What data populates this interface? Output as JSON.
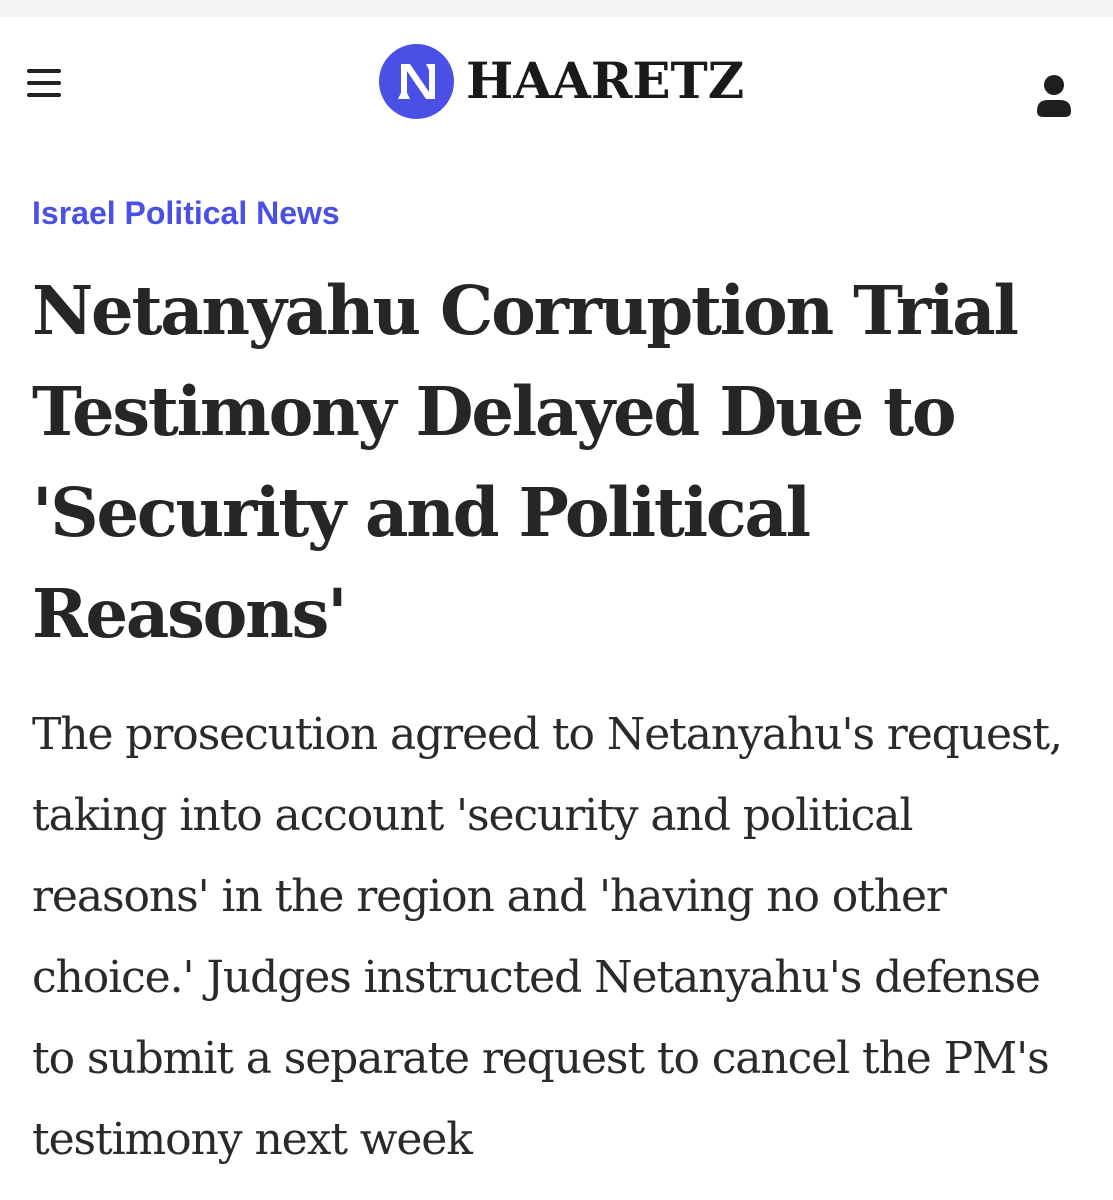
{
  "header": {
    "menu_icon": "hamburger-menu-icon",
    "logo_icon": "haaretz-logo-icon",
    "logo_text": "HAARETZ",
    "account_icon": "user-icon",
    "brand_color": "#4a4fe6"
  },
  "article": {
    "category": "Israel Political News",
    "headline": "Netanyahu Corruption Trial Testimony Delayed Due to 'Security and Political Reasons'",
    "deck": "The prosecution agreed to Netanyahu's request, taking into account 'security and political reasons' in the region and 'having no other choice.' Judges instructed Netanyahu's defense to submit a separate request to cancel the PM's testimony next week"
  }
}
